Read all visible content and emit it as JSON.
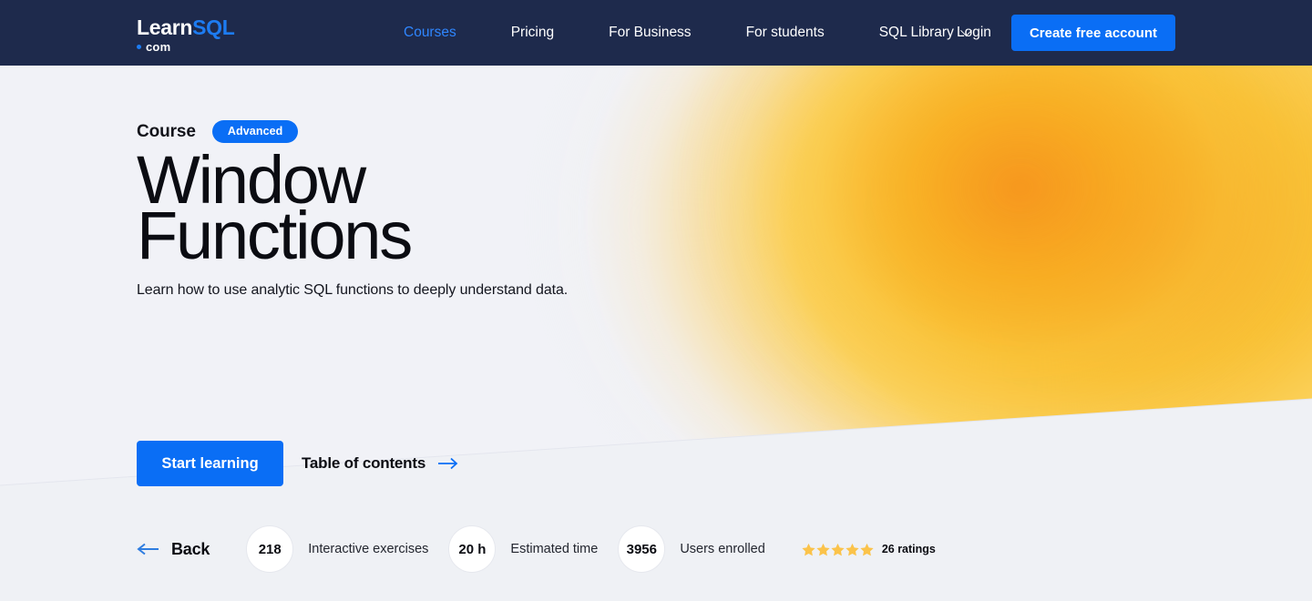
{
  "brand": {
    "logo_main": "Learn",
    "logo_accent": "SQL",
    "logo_sub": "com",
    "accent_blue": "#1d7cf2",
    "navbar_bg": "#1e2a4c"
  },
  "nav": {
    "items": [
      {
        "label": "Courses",
        "active": true,
        "has_chevron": false
      },
      {
        "label": "Pricing",
        "active": false,
        "has_chevron": false
      },
      {
        "label": "For Business",
        "active": false,
        "has_chevron": false
      },
      {
        "label": "For students",
        "active": false,
        "has_chevron": false
      },
      {
        "label": "SQL Library",
        "active": false,
        "has_chevron": true
      }
    ],
    "login_label": "Login",
    "cta_label": "Create free account",
    "cta_color": "#0a6ef5"
  },
  "hero": {
    "course_label": "Course",
    "level_badge": "Advanced",
    "title_line1": "Window",
    "title_line2": "Functions",
    "description": "Learn how to use analytic SQL functions to deeply understand data.",
    "start_button": "Start learning",
    "toc_link": "Table of contents",
    "gradient_colors": [
      "#f59d22",
      "#f9bf30",
      "#fbd058",
      "#f1f2f7"
    ]
  },
  "stats": {
    "back_label": "Back",
    "items": [
      {
        "value": "218",
        "label": "Interactive exercises"
      },
      {
        "value": "20 h",
        "label": "Estimated time"
      },
      {
        "value": "3956",
        "label": "Users enrolled"
      }
    ],
    "rating": {
      "stars": 5,
      "filled": 5,
      "star_color": "#fbc34a",
      "count_label": "26 ratings"
    }
  }
}
